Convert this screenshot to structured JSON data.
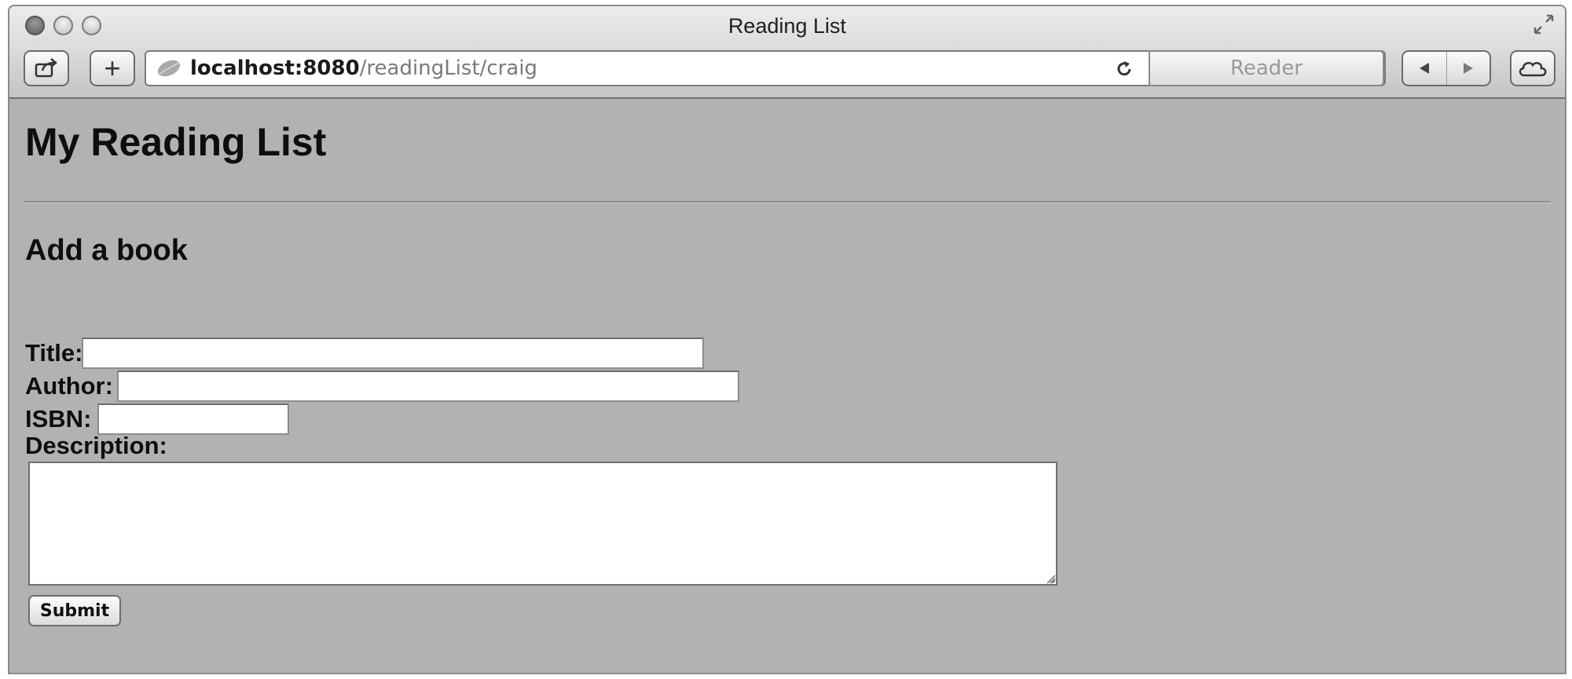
{
  "window": {
    "title": "Reading List"
  },
  "toolbar": {
    "add_label": "+",
    "url_host": "localhost:8080",
    "url_path": "/readingList/craig",
    "reader_label": "Reader"
  },
  "icons": {
    "share": "share-icon",
    "favicon": "leaf-favicon-icon",
    "reload": "reload-icon",
    "back": "back-arrow-icon",
    "forward": "forward-arrow-icon",
    "cloud": "cloud-icon",
    "fullscreen": "fullscreen-icon"
  },
  "page": {
    "title": "My Reading List",
    "section_heading": "Add a book"
  },
  "form": {
    "title_label": "Title:",
    "title_value": "",
    "author_label": "Author:",
    "author_value": "",
    "isbn_label": "ISBN:",
    "isbn_value": "",
    "description_label": "Description:",
    "description_value": "",
    "submit_label": "Submit"
  }
}
